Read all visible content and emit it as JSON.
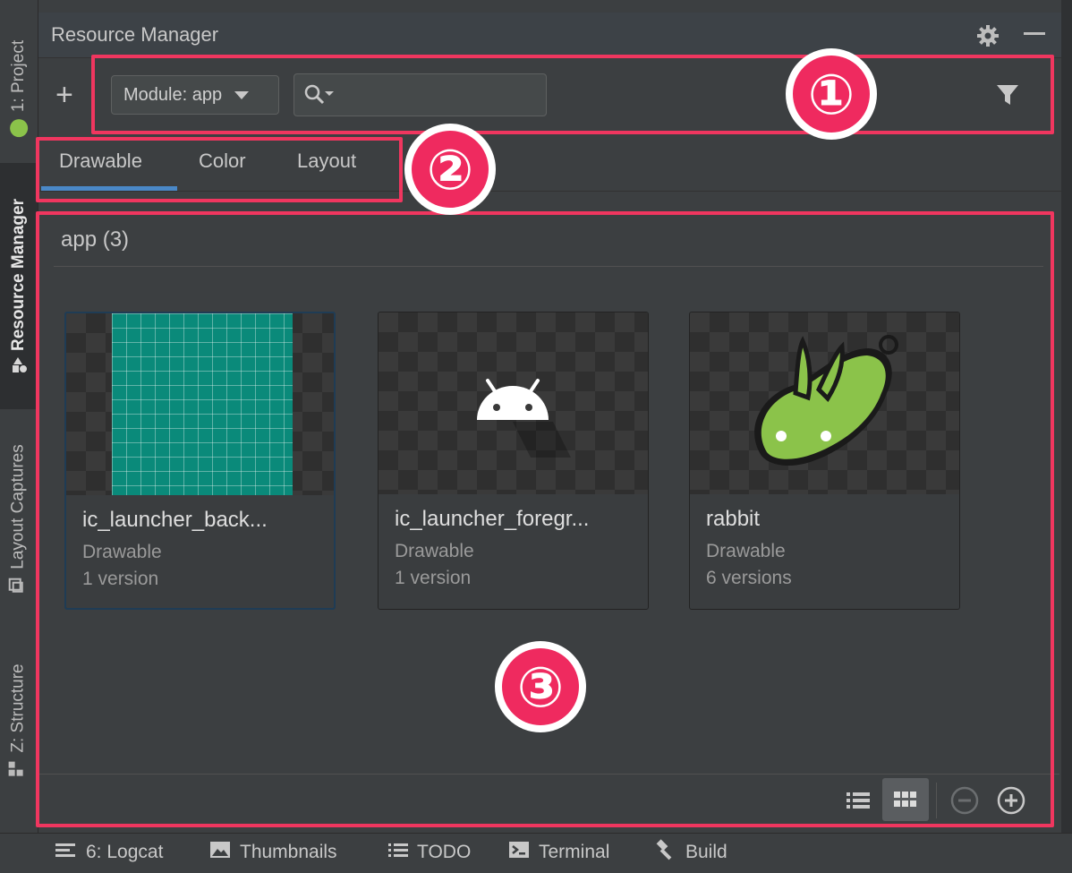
{
  "left_tool_strip": {
    "tabs": [
      {
        "label": "1: Project",
        "icon": "android-icon"
      },
      {
        "label": "Resource Manager",
        "icon": "resource-manager-icon",
        "active": true
      },
      {
        "label": "Layout Captures",
        "icon": "layout-captures-icon"
      },
      {
        "label": "Z: Structure",
        "icon": "structure-icon"
      }
    ]
  },
  "panel": {
    "title": "Resource Manager",
    "header_icons": [
      "gear-icon",
      "minimize-icon"
    ]
  },
  "toolbar": {
    "add_icon": "+",
    "module_select": "Module: app",
    "search_placeholder": "",
    "filter_icon": "filter-icon"
  },
  "tabs": [
    {
      "label": "Drawable",
      "selected": true
    },
    {
      "label": "Color"
    },
    {
      "label": "Layout"
    }
  ],
  "section": {
    "title": "app (3)"
  },
  "resources": [
    {
      "name": "ic_launcher_back...",
      "type": "Drawable",
      "versions": "1 version",
      "selected": true
    },
    {
      "name": "ic_launcher_foregr...",
      "type": "Drawable",
      "versions": "1 version"
    },
    {
      "name": "rabbit",
      "type": "Drawable",
      "versions": "6 versions"
    }
  ],
  "footer_controls": [
    "list-view-icon",
    "grid-view-icon",
    "zoom-out-icon",
    "zoom-in-icon"
  ],
  "annotations": [
    {
      "label": "①"
    },
    {
      "label": "②"
    },
    {
      "label": "③"
    }
  ],
  "bottom_bar": [
    {
      "label": "6: Logcat",
      "icon": "logcat-icon"
    },
    {
      "label": "Thumbnails",
      "icon": "thumbnails-icon"
    },
    {
      "label": "TODO",
      "icon": "todo-icon"
    },
    {
      "label": "Terminal",
      "icon": "terminal-icon"
    },
    {
      "label": "Build",
      "icon": "hammer-icon"
    }
  ],
  "colors": {
    "accent_tab": "#4a88c7",
    "annotation": "#ef2a5f",
    "teal": "#0a8a7a",
    "rabbit_green": "#8bc34a"
  }
}
